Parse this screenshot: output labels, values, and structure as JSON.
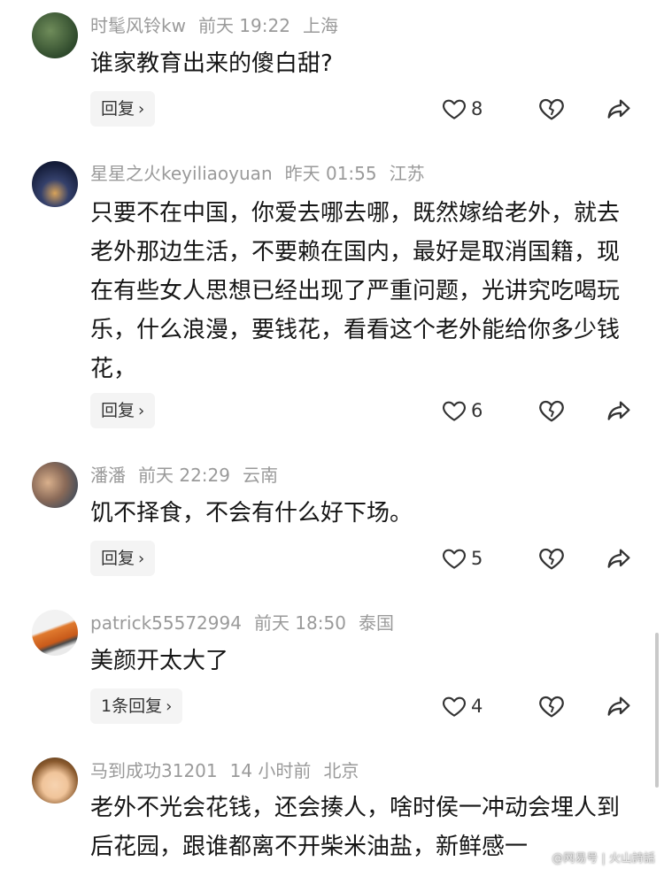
{
  "comments": [
    {
      "username": "时髦风铃kw",
      "time": "前天 19:22",
      "location": "上海",
      "text": "谁家教育出来的傻白甜?",
      "reply_label": "回复",
      "like_count": "8"
    },
    {
      "username": "星星之火keyiliaoyuan",
      "time": "昨天 01:55",
      "location": "江苏",
      "text": "只要不在中国，你爱去哪去哪，既然嫁给老外，就去老外那边生活，不要赖在国内，最好是取消国籍，现在有些女人思想已经出现了严重问题，光讲究吃喝玩乐，什么浪漫，要钱花，看看这个老外能给你多少钱花，",
      "reply_label": "回复",
      "like_count": "6"
    },
    {
      "username": "潘潘",
      "time": "前天 22:29",
      "location": "云南",
      "text": "饥不择食，不会有什么好下场。",
      "reply_label": "回复",
      "like_count": "5"
    },
    {
      "username": "patrick55572994",
      "time": "前天 18:50",
      "location": "泰国",
      "text": "美颜开太大了",
      "reply_label": "1条回复",
      "like_count": "4"
    },
    {
      "username": "马到成功31201",
      "time": "14 小时前",
      "location": "北京",
      "text": "老外不光会花钱，还会揍人，啥时侯一冲动会埋人到后花园，跟谁都离不开柴米油盐，新鲜感一"
    }
  ],
  "watermark": "@网易号 | 火山詩話",
  "colors": {
    "meta": "#9a9a9a",
    "text": "#161616",
    "reply_bg": "#f4f4f4"
  }
}
